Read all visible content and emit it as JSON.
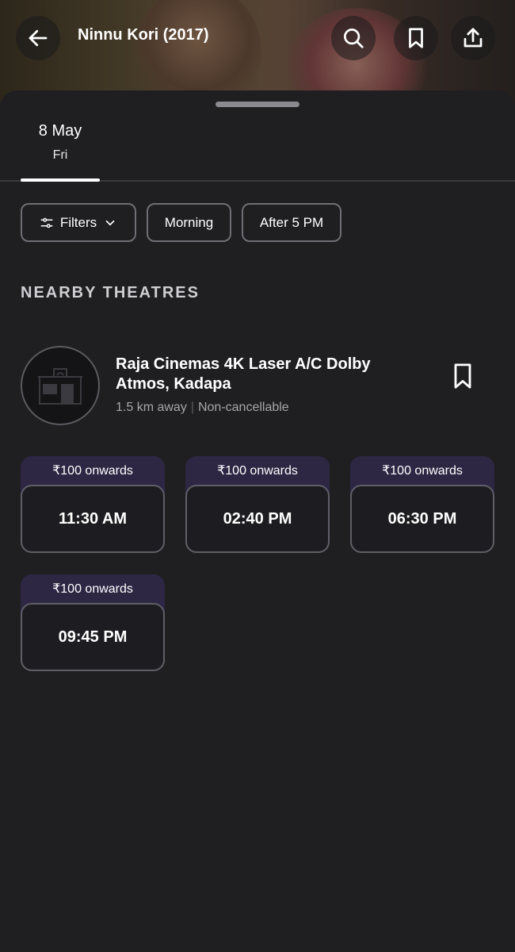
{
  "header": {
    "title": "Ninnu Kori (2017)",
    "back_icon": "arrow-left-icon",
    "search_icon": "search-icon",
    "bookmark_icon": "bookmark-icon",
    "share_icon": "share-icon"
  },
  "date_tab": {
    "date": "8 May",
    "day": "Fri"
  },
  "filters": {
    "filters_label": "Filters",
    "morning_label": "Morning",
    "after5_label": "After 5 PM"
  },
  "section": {
    "title": "NEARBY THEATRES"
  },
  "theatre": {
    "name": "Raja Cinemas 4K Laser A/C Dolby Atmos, Kadapa",
    "distance": "1.5 km away",
    "policy": "Non-cancellable"
  },
  "showtimes": [
    {
      "price": "₹100 onwards",
      "time": "11:30 AM"
    },
    {
      "price": "₹100 onwards",
      "time": "02:40 PM"
    },
    {
      "price": "₹100 onwards",
      "time": "06:30 PM"
    },
    {
      "price": "₹100 onwards",
      "time": "09:45 PM"
    }
  ],
  "colors": {
    "background": "#1f1f22",
    "price_band": "#2d2744",
    "border": "#5e5e66"
  }
}
